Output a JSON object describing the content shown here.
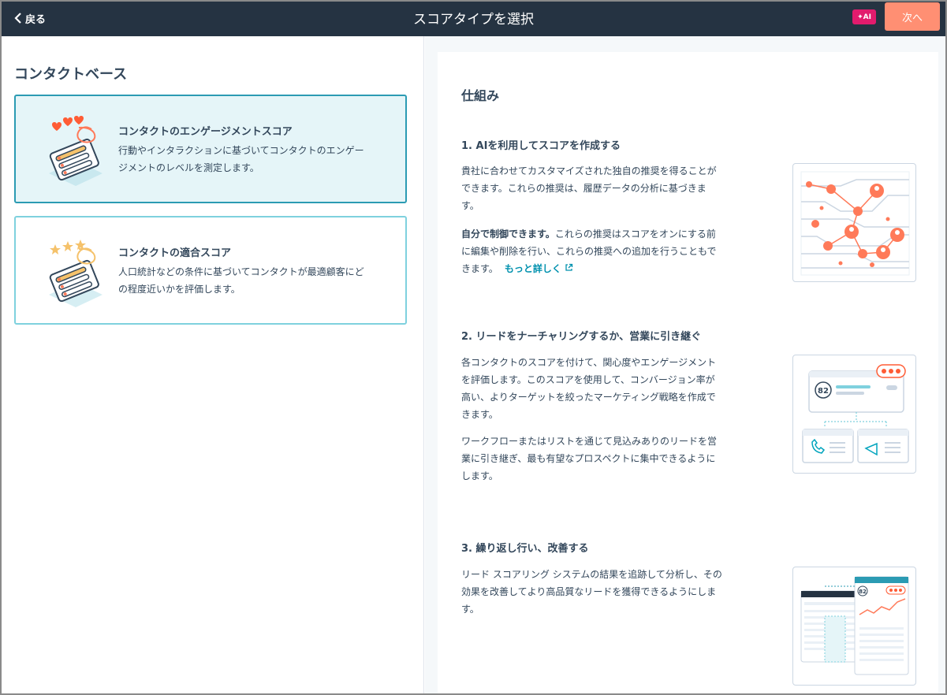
{
  "header": {
    "back_label": "戻る",
    "title": "スコアタイプを選択",
    "ai_badge": "✦AI",
    "next_label": "次へ"
  },
  "left": {
    "section_title": "コンタクトベース",
    "cards": [
      {
        "title": "コンタクトのエンゲージメントスコア",
        "desc_line1": "行動やインタラクションに基づいてコンタクトのエンゲー",
        "desc_line2": "ジメントのレベルを測定します。",
        "selected": true
      },
      {
        "title": "コンタクトの適合スコア",
        "desc_line1": "人口統計などの条件に基づいてコンタクトが最適顧客にど",
        "desc_line2": "の程度近いかを評価します。",
        "selected": false
      }
    ]
  },
  "right": {
    "title": "仕組み",
    "steps": [
      {
        "title": "1. AIを利用してスコアを作成する",
        "p1_line1": "貴社に合わせてカスタマイズされた独自の推奨を得ることが",
        "p1_line2": "できます。これらの推奨は、履歴データの分析に基づきま",
        "p1_line3": "す。",
        "p2_bold": "自分で制御できます。",
        "p2_line1": "これらの推奨はスコアをオンにする前",
        "p2_line2": "に編集や削除を行い、これらの推奨への追加を行うこともで",
        "p2_line3": "きます。",
        "link": "もっと詳しく"
      },
      {
        "title": "2. リードをナーチャリングするか、営業に引き継ぐ",
        "p1_line1": "各コンタクトのスコアを付けて、関心度やエンゲージメント",
        "p1_line2": "を評価します。このスコアを使用して、コンバージョン率が",
        "p1_line3": "高い、よりターゲットを絞ったマーケティング戦略を作成で",
        "p1_line4": "きます。",
        "p2_line1": "ワークフローまたはリストを通じて見込みありのリードを営",
        "p2_line2": "業に引き継ぎ、最も有望なプロスペクトに集中できるように",
        "p2_line3": "します。",
        "score": "82"
      },
      {
        "title": "3. 繰り返し行い、改善する",
        "p1_line1": "リード スコアリング システムの結果を追跡して分析し、その",
        "p1_line2": "効果を改善してより高品質なリードを獲得できるようにしま",
        "p1_line3": "す。",
        "score": "82"
      }
    ]
  },
  "colors": {
    "header_bg": "#253342",
    "accent_teal": "#2b9bb3",
    "next_button": "#ff8f73",
    "ai_badge": "#e21b6d",
    "link": "#0091ae",
    "illustration_orange": "#ff7a59"
  }
}
